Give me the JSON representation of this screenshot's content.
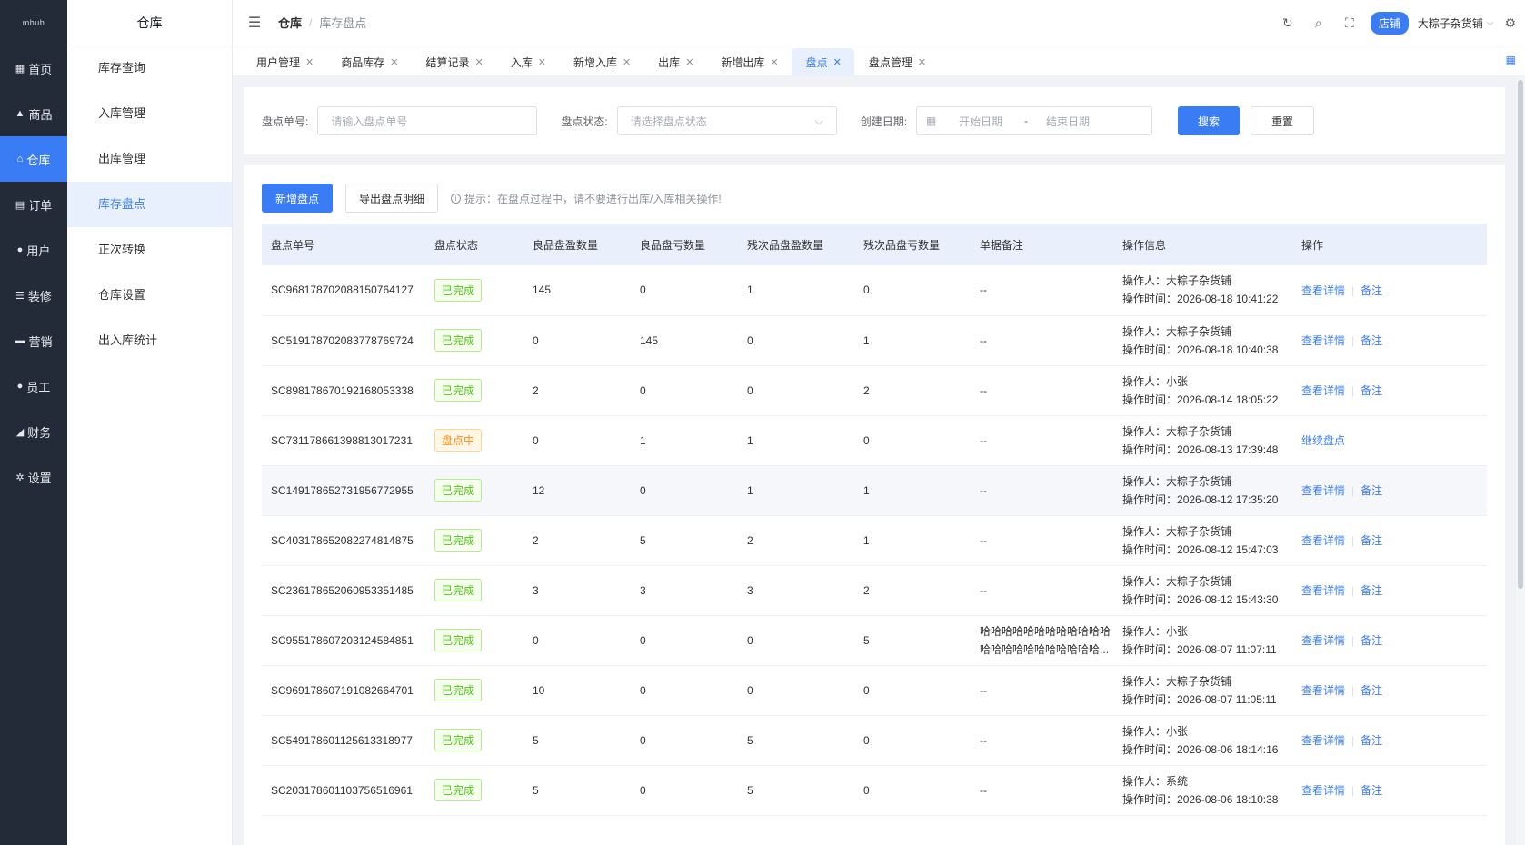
{
  "app": {
    "logo_text": "mhub"
  },
  "rail": [
    {
      "icon": "home-icon",
      "glyph": "▦",
      "label": "首页",
      "active": false
    },
    {
      "icon": "goods-icon",
      "glyph": "▲",
      "label": "商品",
      "active": false
    },
    {
      "icon": "warehouse-icon",
      "glyph": "⌂",
      "label": "仓库",
      "active": true
    },
    {
      "icon": "order-icon",
      "glyph": "▤",
      "label": "订单",
      "active": false
    },
    {
      "icon": "user-icon",
      "glyph": "●",
      "label": "用户",
      "active": false
    },
    {
      "icon": "decorate-icon",
      "glyph": "☰",
      "label": "装修",
      "active": false
    },
    {
      "icon": "marketing-icon",
      "glyph": "▬",
      "label": "营销",
      "active": false
    },
    {
      "icon": "staff-icon",
      "glyph": "●",
      "label": "员工",
      "active": false
    },
    {
      "icon": "finance-icon",
      "glyph": "◢",
      "label": "财务",
      "active": false
    },
    {
      "icon": "settings-icon",
      "glyph": "✲",
      "label": "设置",
      "active": false
    }
  ],
  "submenu": {
    "title": "仓库",
    "items": [
      {
        "label": "库存查询",
        "active": false
      },
      {
        "label": "入库管理",
        "active": false
      },
      {
        "label": "出库管理",
        "active": false
      },
      {
        "label": "库存盘点",
        "active": true
      },
      {
        "label": "正次转换",
        "active": false
      },
      {
        "label": "仓库设置",
        "active": false
      },
      {
        "label": "出入库统计",
        "active": false
      }
    ]
  },
  "header": {
    "breadcrumb_1": "仓库",
    "breadcrumb_sep": "/",
    "breadcrumb_2": "库存盘点",
    "shop_badge": "店铺",
    "shop_name": "大粽子杂货铺"
  },
  "tabs": [
    {
      "label": "用户管理",
      "active": false
    },
    {
      "label": "商品库存",
      "active": false
    },
    {
      "label": "结算记录",
      "active": false
    },
    {
      "label": "入库",
      "active": false
    },
    {
      "label": "新增入库",
      "active": false
    },
    {
      "label": "出库",
      "active": false
    },
    {
      "label": "新增出库",
      "active": false
    },
    {
      "label": "盘点",
      "active": true
    },
    {
      "label": "盘点管理",
      "active": false
    }
  ],
  "filters": {
    "order_no_label": "盘点单号:",
    "order_no_placeholder": "请输入盘点单号",
    "status_label": "盘点状态:",
    "status_placeholder": "请选择盘点状态",
    "date_label": "创建日期:",
    "date_start_placeholder": "开始日期",
    "date_sep": "-",
    "date_end_placeholder": "结束日期",
    "search_btn": "搜索",
    "reset_btn": "重置"
  },
  "actions": {
    "add_btn": "新增盘点",
    "export_btn": "导出盘点明细",
    "tip": "提示：在盘点过程中，请不要进行出库/入库相关操作!"
  },
  "table": {
    "columns": [
      "盘点单号",
      "盘点状态",
      "良品盘盈数量",
      "良品盘亏数量",
      "残次品盘盈数量",
      "残次品盘亏数量",
      "单据备注",
      "操作信息",
      "操作"
    ],
    "operator_prefix": "操作人：",
    "time_prefix": "操作时间：",
    "rows": [
      {
        "no": "SC968178702088150764127",
        "status": "已完成",
        "status_type": "done",
        "good_gain": "145",
        "good_loss": "0",
        "bad_gain": "1",
        "bad_loss": "0",
        "remark": [
          "--"
        ],
        "operator": "大粽子杂货铺",
        "time": "2026-08-18 10:41:22",
        "ops": [
          "查看详情",
          "备注"
        ],
        "highlight": false
      },
      {
        "no": "SC519178702083778769724",
        "status": "已完成",
        "status_type": "done",
        "good_gain": "0",
        "good_loss": "145",
        "bad_gain": "0",
        "bad_loss": "1",
        "remark": [
          "--"
        ],
        "operator": "大粽子杂货铺",
        "time": "2026-08-18 10:40:38",
        "ops": [
          "查看详情",
          "备注"
        ],
        "highlight": false
      },
      {
        "no": "SC898178670192168053338",
        "status": "已完成",
        "status_type": "done",
        "good_gain": "2",
        "good_loss": "0",
        "bad_gain": "0",
        "bad_loss": "2",
        "remark": [
          "--"
        ],
        "operator": "小张",
        "time": "2026-08-14 18:05:22",
        "ops": [
          "查看详情",
          "备注"
        ],
        "highlight": false
      },
      {
        "no": "SC731178661398813017231",
        "status": "盘点中",
        "status_type": "doing",
        "good_gain": "0",
        "good_loss": "1",
        "bad_gain": "1",
        "bad_loss": "0",
        "remark": [
          "--"
        ],
        "operator": "大粽子杂货铺",
        "time": "2026-08-13 17:39:48",
        "ops": [
          "继续盘点"
        ],
        "highlight": false
      },
      {
        "no": "SC149178652731956772955",
        "status": "已完成",
        "status_type": "done",
        "good_gain": "12",
        "good_loss": "0",
        "bad_gain": "1",
        "bad_loss": "1",
        "remark": [
          "--"
        ],
        "operator": "大粽子杂货铺",
        "time": "2026-08-12 17:35:20",
        "ops": [
          "查看详情",
          "备注"
        ],
        "highlight": true
      },
      {
        "no": "SC403178652082274814875",
        "status": "已完成",
        "status_type": "done",
        "good_gain": "2",
        "good_loss": "5",
        "bad_gain": "2",
        "bad_loss": "1",
        "remark": [
          "--"
        ],
        "operator": "大粽子杂货铺",
        "time": "2026-08-12 15:47:03",
        "ops": [
          "查看详情",
          "备注"
        ],
        "highlight": false
      },
      {
        "no": "SC236178652060953351485",
        "status": "已完成",
        "status_type": "done",
        "good_gain": "3",
        "good_loss": "3",
        "bad_gain": "3",
        "bad_loss": "2",
        "remark": [
          "--"
        ],
        "operator": "大粽子杂货铺",
        "time": "2026-08-12 15:43:30",
        "ops": [
          "查看详情",
          "备注"
        ],
        "highlight": false
      },
      {
        "no": "SC955178607203124584851",
        "status": "已完成",
        "status_type": "done",
        "good_gain": "0",
        "good_loss": "0",
        "bad_gain": "0",
        "bad_loss": "5",
        "remark": [
          "哈哈哈哈哈哈哈哈哈哈哈哈",
          "哈哈哈哈哈哈哈哈哈哈哈..."
        ],
        "operator": "小张",
        "time": "2026-08-07 11:07:11",
        "ops": [
          "查看详情",
          "备注"
        ],
        "highlight": false
      },
      {
        "no": "SC969178607191082664701",
        "status": "已完成",
        "status_type": "done",
        "good_gain": "10",
        "good_loss": "0",
        "bad_gain": "0",
        "bad_loss": "0",
        "remark": [
          "--"
        ],
        "operator": "大粽子杂货铺",
        "time": "2026-08-07 11:05:11",
        "ops": [
          "查看详情",
          "备注"
        ],
        "highlight": false
      },
      {
        "no": "SC549178601125613318977",
        "status": "已完成",
        "status_type": "done",
        "good_gain": "5",
        "good_loss": "0",
        "bad_gain": "5",
        "bad_loss": "0",
        "remark": [
          "--"
        ],
        "operator": "小张",
        "time": "2026-08-06 18:14:16",
        "ops": [
          "查看详情",
          "备注"
        ],
        "highlight": false
      },
      {
        "no": "SC203178601103756516961",
        "status": "已完成",
        "status_type": "done",
        "good_gain": "5",
        "good_loss": "0",
        "bad_gain": "5",
        "bad_loss": "0",
        "remark": [
          "--"
        ],
        "operator": "系统",
        "time": "2026-08-06 18:10:38",
        "ops": [
          "查看详情",
          "备注"
        ],
        "highlight": false
      }
    ]
  },
  "colors": {
    "primary": "#3a7cf4",
    "rail_bg": "#232b38",
    "status_done": "#52c41a",
    "status_doing": "#fa8c16"
  }
}
